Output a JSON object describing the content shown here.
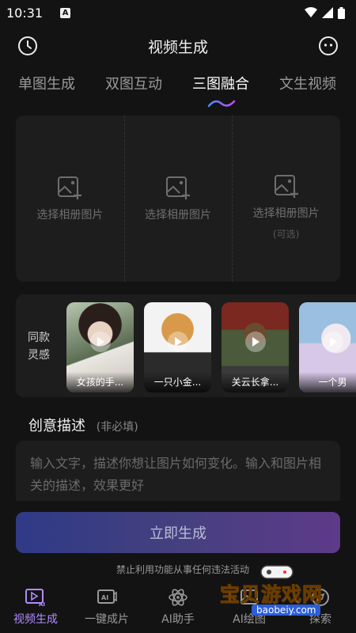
{
  "status_bar": {
    "time": "10:31",
    "notification_letter": "A"
  },
  "header": {
    "title": "视频生成"
  },
  "tabs": [
    {
      "label": "单图生成",
      "active": false
    },
    {
      "label": "双图互动",
      "active": false
    },
    {
      "label": "三图融合",
      "active": true
    },
    {
      "label": "文生视频",
      "active": false
    }
  ],
  "upload": {
    "slots": [
      {
        "label": "选择相册图片",
        "sub": ""
      },
      {
        "label": "选择相册图片",
        "sub": ""
      },
      {
        "label": "选择相册图片",
        "sub": "(可选)"
      }
    ]
  },
  "inspiration": {
    "label": "同款灵感",
    "cards": [
      {
        "caption": "女孩的手..."
      },
      {
        "caption": "一只小金..."
      },
      {
        "caption": "关云长拿..."
      },
      {
        "caption": "一个男"
      }
    ]
  },
  "description": {
    "title": "创意描述",
    "hint": "(非必填)",
    "placeholder": "输入文字，描述你想让图片如何变化。输入和图片相关的描述，效果更好"
  },
  "generate_button": {
    "label": "立即生成"
  },
  "disclaimer": "禁止利用功能从事任何违法活动",
  "bottom_nav": [
    {
      "label": "视频生成",
      "active": true,
      "icon": "video-ai-icon"
    },
    {
      "label": "一键成片",
      "active": false,
      "icon": "ai-clip-icon"
    },
    {
      "label": "AI助手",
      "active": false,
      "icon": "atom-icon"
    },
    {
      "label": "AI绘图",
      "active": false,
      "icon": "paint-icon"
    },
    {
      "label": "探索",
      "active": false,
      "icon": "explore-icon"
    }
  ],
  "watermark": {
    "text": "宝贝游戏网",
    "url": "baobeiy.com"
  },
  "colors": {
    "accent": "#b28bff",
    "background": "#131313",
    "panel": "#1d1d1d"
  }
}
